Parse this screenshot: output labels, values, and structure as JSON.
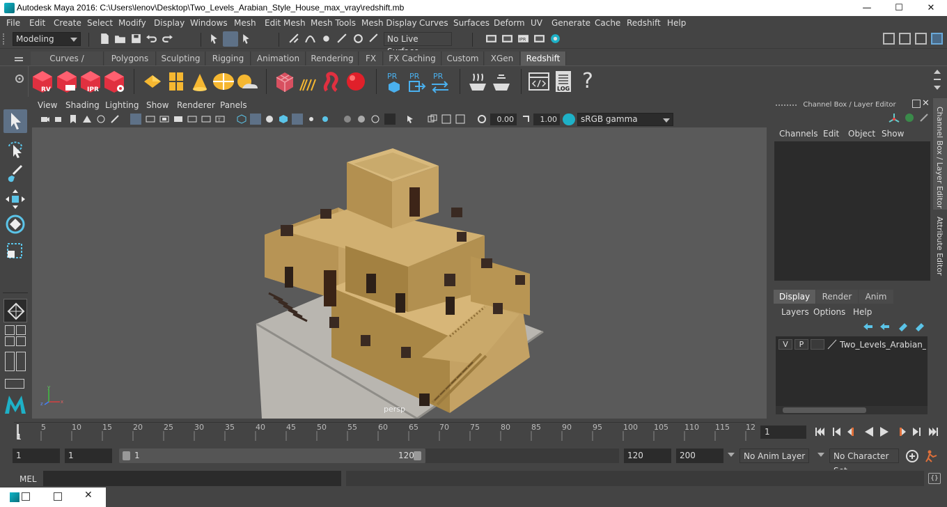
{
  "window": {
    "title": "Autodesk Maya 2016: C:\\Users\\lenov\\Desktop\\Two_Levels_Arabian_Style_House_max_vray\\redshift.mb",
    "minimize": "—",
    "maximize": "☐",
    "close": "✕"
  },
  "menubar": [
    "File",
    "Edit",
    "Create",
    "Select",
    "Modify",
    "Display",
    "Windows",
    "Mesh",
    "Edit Mesh",
    "Mesh Tools",
    "Mesh Display",
    "Curves",
    "Surfaces",
    "Deform",
    "UV",
    "Generate",
    "Cache",
    "Redshift",
    "Help"
  ],
  "status": {
    "mode": "Modeling",
    "live_surface": "No Live Surface"
  },
  "shelf_tabs": [
    "Curves / Surfaces",
    "Polygons",
    "Sculpting",
    "Rigging",
    "Animation",
    "Rendering",
    "FX",
    "FX Caching",
    "Custom",
    "XGen",
    "Redshift"
  ],
  "shelf_active": "Redshift",
  "shelf_icon_labels": {
    "rv": "RV",
    "ipr": "IPR",
    "pr1": "PR",
    "pr2": "PR",
    "pr3": "PR",
    "log": "LOG",
    "help": "?"
  },
  "panel_menu": [
    "View",
    "Shading",
    "Lighting",
    "Show",
    "Renderer",
    "Panels"
  ],
  "panel_toolbar": {
    "exposure": "0.00",
    "gamma": "1.00",
    "color_space": "sRGB gamma"
  },
  "viewport": {
    "camera": "persp"
  },
  "channel_box": {
    "title": "Channel Box / Layer Editor",
    "menus": [
      "Channels",
      "Edit",
      "Object",
      "Show"
    ]
  },
  "layer_editor": {
    "tabs": [
      "Display",
      "Render",
      "Anim"
    ],
    "active_tab": "Display",
    "menus": [
      "Layers",
      "Options",
      "Help"
    ],
    "layer": {
      "visible": "V",
      "playback": "P",
      "name": "Two_Levels_Arabian_Styl"
    }
  },
  "side_tabs": [
    "Channel Box / Layer Editor",
    "Attribute Editor"
  ],
  "time_slider": {
    "ticks": [
      "1",
      "5",
      "10",
      "15",
      "20",
      "25",
      "30",
      "35",
      "40",
      "45",
      "50",
      "55",
      "60",
      "65",
      "70",
      "75",
      "80",
      "85",
      "90",
      "95",
      "100",
      "105",
      "110",
      "115",
      "12"
    ],
    "current_frame": "1"
  },
  "range": {
    "start": "1",
    "playback_start": "1",
    "slider_start": "1",
    "slider_end": "120",
    "playback_end": "120",
    "end": "200",
    "anim_layer": "No Anim Layer",
    "character_set": "No Character Set"
  },
  "command_line": {
    "label": "MEL"
  }
}
